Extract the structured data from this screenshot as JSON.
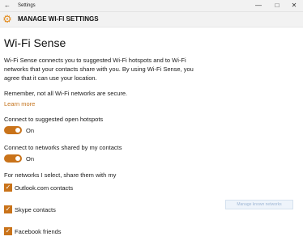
{
  "window": {
    "title": "Settings",
    "back_glyph": "←",
    "minimize_glyph": "—",
    "maximize_glyph": "□",
    "close_glyph": "✕"
  },
  "header": {
    "icon": "gear-icon",
    "gear_glyph": "⚙",
    "title": "MANAGE WI-FI SETTINGS"
  },
  "page": {
    "title": "Wi-Fi Sense",
    "description": "Wi-Fi Sense connects you to suggested Wi-Fi hotspots and to Wi-Fi networks that your contacts share with you. By using Wi-Fi Sense, you agree that it can use your location.",
    "remember": "Remember, not all Wi-Fi networks are secure.",
    "learn_more": "Learn more"
  },
  "toggles": [
    {
      "label": "Connect to suggested open hotspots",
      "state": "On",
      "on": true
    },
    {
      "label": "Connect to networks shared by my contacts",
      "state": "On",
      "on": true
    }
  ],
  "share_heading": "For networks I select, share them with my",
  "checkboxes": [
    {
      "label": "Outlook.com contacts",
      "checked": true
    },
    {
      "label": "Skype contacts",
      "checked": true
    },
    {
      "label": "Facebook friends",
      "checked": true
    }
  ],
  "checkmark_glyph": "✓",
  "ghost_button": {
    "label": "Manage known networks"
  },
  "colors": {
    "accent": "#c9731a",
    "link": "#c4731c",
    "header_bg": "#f2f2f2"
  }
}
